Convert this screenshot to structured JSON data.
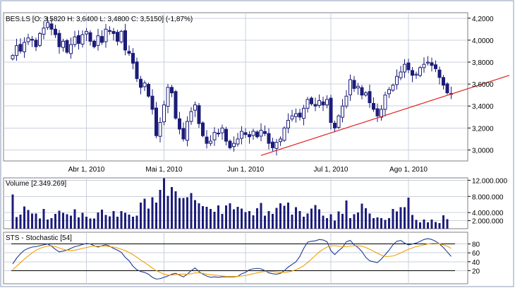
{
  "legend_price": "BES.LS [O: 3,5820  H: 3,6400  L: 3,4800  C: 3,5150] (-1,87%)",
  "legend_volume": "Volume [2.349.269]",
  "legend_stochastic": "STS - Stochastic [54]",
  "colors": {
    "candle": "#1c1c7a",
    "candle_up_body": "#ffffff",
    "volume": "#1c1c7a",
    "trendline": "#e02020",
    "stoch_k": "#1f3a93",
    "stoch_d": "#f0a000",
    "grid": "#c9d0dc",
    "frame": "#8a9bb8"
  },
  "chart_data": [
    {
      "type": "candlestick",
      "title": "BES.LS [O: 3,5820  H: 3,6400  L: 3,4800  C: 3,5150] (-1,87%)",
      "ylim": [
        2.9,
        4.25
      ],
      "yticks": [
        3.0,
        3.2,
        3.4,
        3.6,
        3.8,
        4.0,
        4.2
      ],
      "ytick_labels": [
        "3,0000",
        "3,2000",
        "3,4000",
        "3,6000",
        "3,8000",
        "4,0000",
        "4,2000"
      ],
      "xticks": [
        {
          "index": 19,
          "label": "Abr 1, 2010"
        },
        {
          "index": 39,
          "label": "Mai 1, 2010"
        },
        {
          "index": 60,
          "label": "Jun 1, 2010"
        },
        {
          "index": 82,
          "label": "Jul 1, 2010"
        },
        {
          "index": 102,
          "label": "Ago 1, 2010"
        }
      ],
      "grid": true,
      "close": [
        3.86,
        3.95,
        3.9,
        3.98,
        4.02,
        4.0,
        3.94,
        4.06,
        4.11,
        4.16,
        4.1,
        4.05,
        3.94,
        3.99,
        3.89,
        3.96,
        4.03,
        3.97,
        4.05,
        4.08,
        3.99,
        3.94,
        4.04,
        3.98,
        4.1,
        4.08,
        4.06,
        3.99,
        4.08,
        3.91,
        3.88,
        3.79,
        3.65,
        3.57,
        3.61,
        3.49,
        3.37,
        3.13,
        3.25,
        3.41,
        3.57,
        3.52,
        3.29,
        3.19,
        3.1,
        3.26,
        3.35,
        3.41,
        3.24,
        3.13,
        3.06,
        3.08,
        3.16,
        3.15,
        3.2,
        3.08,
        3.02,
        3.06,
        3.1,
        3.17,
        3.14,
        3.12,
        3.17,
        3.12,
        3.18,
        3.15,
        3.06,
        3.02,
        3.07,
        3.1,
        3.2,
        3.27,
        3.31,
        3.33,
        3.3,
        3.38,
        3.46,
        3.42,
        3.4,
        3.45,
        3.41,
        3.46,
        3.25,
        3.2,
        3.31,
        3.4,
        3.49,
        3.64,
        3.56,
        3.58,
        3.5,
        3.52,
        3.43,
        3.37,
        3.31,
        3.37,
        3.5,
        3.55,
        3.59,
        3.67,
        3.71,
        3.78,
        3.73,
        3.68,
        3.69,
        3.75,
        3.78,
        3.8,
        3.77,
        3.74,
        3.66,
        3.59,
        3.52,
        3.51
      ],
      "volume": {
        "title": "Volume [2.349.269]",
        "ylim": [
          0,
          12600000
        ],
        "yticks": [
          2000000,
          4000000,
          8000000,
          12000000
        ],
        "ytick_labels": [
          "2.000.000",
          "4.000.000",
          "8.000.000",
          "12.000.000"
        ],
        "values": [
          8500000,
          2900000,
          3500000,
          5500000,
          4600000,
          3800000,
          3800000,
          2500000,
          4900000,
          2300000,
          2600000,
          3700000,
          4500000,
          3900000,
          3600000,
          3200000,
          4800000,
          2800000,
          3900000,
          3000000,
          2500000,
          2500000,
          4000000,
          4700000,
          3400000,
          3100000,
          4400000,
          3000000,
          4400000,
          3900000,
          3500000,
          3000000,
          3200000,
          6500000,
          7400000,
          5000000,
          7800000,
          6500000,
          9600000,
          12500000,
          8100000,
          10300000,
          9300000,
          7600000,
          7600000,
          7800000,
          8800000,
          7100000,
          6300000,
          5600000,
          5400000,
          4900000,
          4200000,
          5800000,
          3700000,
          5800000,
          6300000,
          4800000,
          5400000,
          5000000,
          4100000,
          4400000,
          3300000,
          5100000,
          6400000,
          3200000,
          4400000,
          3700000,
          5200000,
          6300000,
          5700000,
          6500000,
          3500000,
          5300000,
          4400000,
          3000000,
          3800000,
          5000000,
          5900000,
          4800000,
          3200000,
          2600000,
          3600000,
          2000000,
          4300000,
          3700000,
          7000000,
          2600000,
          3600000,
          4000000,
          6200000,
          5100000,
          3800000,
          2600000,
          2800000,
          2600000,
          2200000,
          2600000,
          4900000,
          4300000,
          5300000,
          5300000,
          7700000,
          3400000,
          2200000,
          1600000,
          2300000,
          1600000,
          2300000,
          1700000,
          1400000,
          3300000,
          2349269
        ]
      },
      "stochastic": {
        "title": "STS - Stochastic [54]",
        "ylim": [
          0,
          100
        ],
        "yticks": [
          20,
          40,
          60,
          80
        ],
        "ytick_labels": [
          "20",
          "40",
          "60",
          "80"
        ],
        "reference_lines": [
          20,
          80
        ],
        "series": [
          {
            "name": "",
            "values": [
              35,
              48,
              58,
              66,
              70,
              73,
              74,
              76,
              78,
              80,
              75,
              68,
              62,
              64,
              66,
              70,
              74,
              76,
              79,
              81,
              80,
              76,
              73,
              76,
              78,
              75,
              70,
              66,
              61,
              50,
              42,
              30,
              22,
              18,
              16,
              12,
              5,
              1,
              2,
              5,
              8,
              12,
              14,
              10,
              6,
              12,
              20,
              26,
              18,
              12,
              8,
              5,
              6,
              5,
              6,
              6,
              6,
              6,
              7,
              13,
              16,
              22,
              24,
              25,
              24,
              20,
              15,
              13,
              12,
              14,
              20,
              28,
              34,
              40,
              52,
              70,
              84,
              86,
              87,
              90,
              89,
              85,
              65,
              56,
              65,
              72,
              85,
              88,
              78,
              72,
              63,
              50,
              42,
              40,
              38,
              46,
              56,
              66,
              78,
              86,
              88,
              82,
              78,
              80,
              82,
              86,
              90,
              92,
              90,
              86,
              80,
              72,
              62,
              52
            ]
          },
          {
            "name": "",
            "values": [
              22,
              30,
              38,
              46,
              53,
              60,
              66,
              70,
              73,
              75,
              76,
              74,
              71,
              68,
              66,
              65,
              66,
              68,
              70,
              72,
              74,
              75,
              75,
              75,
              75,
              74,
              73,
              71,
              68,
              65,
              61,
              56,
              50,
              44,
              38,
              32,
              26,
              20,
              16,
              12,
              10,
              10,
              11,
              12,
              12,
              12,
              13,
              15,
              15,
              14,
              12,
              11,
              10,
              9,
              8,
              7,
              7,
              7,
              7,
              8,
              9,
              11,
              13,
              15,
              17,
              18,
              18,
              18,
              17,
              16,
              16,
              17,
              19,
              22,
              26,
              31,
              38,
              46,
              54,
              62,
              68,
              73,
              76,
              76,
              75,
              74,
              74,
              75,
              76,
              76,
              75,
              72,
              68,
              64,
              59,
              55,
              52,
              52,
              53,
              56,
              60,
              64,
              68,
              71,
              74,
              76,
              78,
              80,
              81,
              81,
              80,
              78,
              75,
              70
            ]
          }
        ]
      },
      "trendline": {
        "from": {
          "index": 64,
          "value": 2.95
        },
        "to_value_at_right_edge": 3.68
      }
    }
  ]
}
